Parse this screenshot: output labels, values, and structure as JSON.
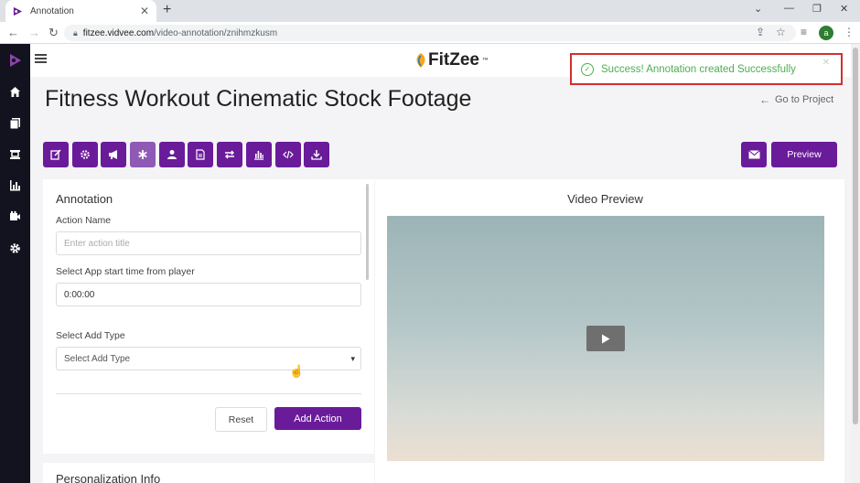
{
  "browser": {
    "tab_title": "Annotation",
    "url_domain": "fitzee.vidvee.com",
    "url_path": "/video-annotation/znihmzkusm",
    "profile_initial": "a"
  },
  "app": {
    "logo_text": "FitZee",
    "logo_mark": "™",
    "sidebar_icons": [
      "home-icon",
      "pages-icon",
      "layout-icon",
      "analytics-icon",
      "video-icon",
      "settings-icon"
    ]
  },
  "toast": {
    "message": "Success! Annotation created Successfully",
    "status_color": "#4caf50"
  },
  "page": {
    "title": "Fitness Workout Cinematic Stock Footage",
    "go_to_project": "Go to Project",
    "preview_button": "Preview",
    "toolbar_icons": [
      "edit-icon",
      "gear-bug-icon",
      "megaphone-icon",
      "asterisk-icon",
      "user-icon",
      "document-icon",
      "swap-icon",
      "bar-chart-icon",
      "code-icon",
      "download-icon"
    ],
    "active_toolbar_index": 3
  },
  "annotation": {
    "heading": "Annotation",
    "action_name_label": "Action Name",
    "action_name_placeholder": "Enter action title",
    "start_time_label": "Select App start time from player",
    "start_time_value": "0:00:00",
    "add_type_label": "Select Add Type",
    "add_type_value": "Select Add Type",
    "reset_button": "Reset",
    "add_action_button": "Add Action"
  },
  "video": {
    "heading": "Video Preview"
  },
  "personalization": {
    "heading": "Personalization Info"
  },
  "colors": {
    "accent": "#6a1b9a",
    "sidebar": "#13131f",
    "highlight_border": "#d32f2f"
  }
}
